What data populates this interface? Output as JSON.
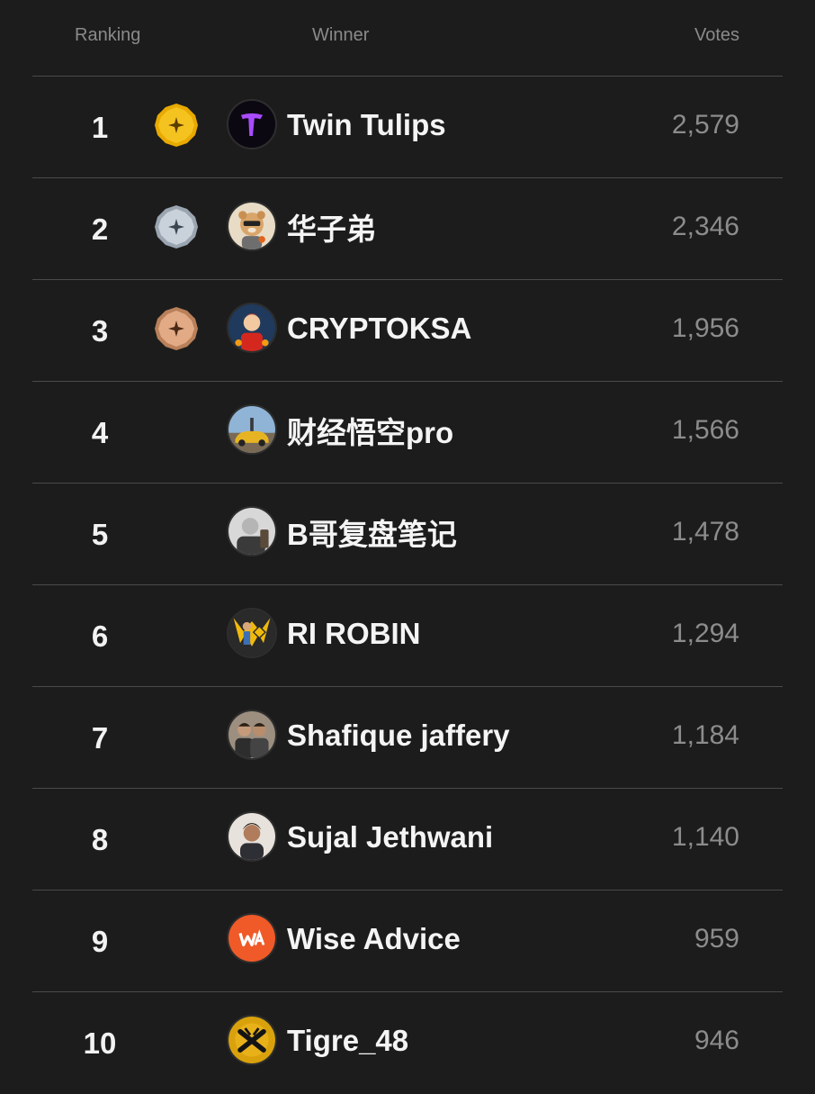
{
  "header": {
    "ranking": "Ranking",
    "winner": "Winner",
    "votes": "Votes"
  },
  "rows": [
    {
      "rank": "1",
      "name": "Twin Tulips",
      "votes": "2,579",
      "medal": "gold",
      "avatar": "twin-tulips-logo"
    },
    {
      "rank": "2",
      "name": "华子弟",
      "votes": "2,346",
      "medal": "silver",
      "avatar": "bear-avatar"
    },
    {
      "rank": "3",
      "name": "CRYPTOKSA",
      "votes": "1,956",
      "medal": "bronze",
      "avatar": "character-avatar"
    },
    {
      "rank": "4",
      "name": "财经悟空pro",
      "votes": "1,566",
      "medal": null,
      "avatar": "car-photo-avatar"
    },
    {
      "rank": "5",
      "name": "B哥复盘笔记",
      "votes": "1,478",
      "medal": null,
      "avatar": "portrait-photo-avatar"
    },
    {
      "rank": "6",
      "name": "RI ROBIN",
      "votes": "1,294",
      "medal": null,
      "avatar": "binance-avatar"
    },
    {
      "rank": "7",
      "name": "Shafique jaffery",
      "votes": "1,184",
      "medal": null,
      "avatar": "two-people-avatar"
    },
    {
      "rank": "8",
      "name": "Sujal Jethwani",
      "votes": "1,140",
      "medal": null,
      "avatar": "person-photo-avatar"
    },
    {
      "rank": "9",
      "name": "Wise Advice",
      "votes": "959",
      "medal": null,
      "avatar": "wa-logo-avatar"
    },
    {
      "rank": "10",
      "name": "Tigre_48",
      "votes": "946",
      "medal": null,
      "avatar": "tigre-logo-avatar"
    }
  ],
  "colors": {
    "background": "#1c1c1c",
    "gold": "#f0b90b",
    "silver": "#b8c2cc",
    "bronze": "#d9a07a"
  }
}
